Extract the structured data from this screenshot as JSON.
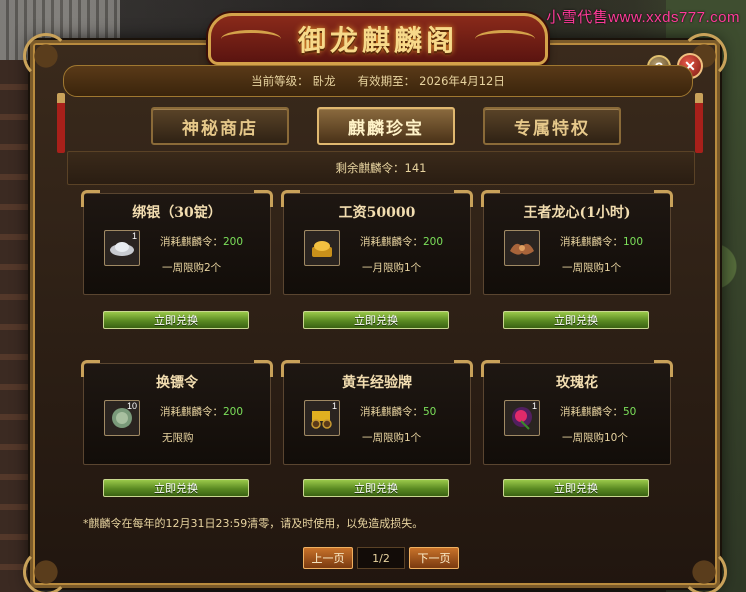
{
  "watermark": "小雪代售www.xxds777.com",
  "window": {
    "title": "御龙麒麟阁",
    "help_label": "?",
    "close_label": "✕"
  },
  "info": {
    "level_label": "当前等级：",
    "level_value": "卧龙",
    "expiry_label": "有效期至：",
    "expiry_value": "2026年4月12日"
  },
  "tabs": [
    {
      "label": "神秘商店",
      "active": false
    },
    {
      "label": "麒麟珍宝",
      "active": true
    },
    {
      "label": "专属特权",
      "active": false
    }
  ],
  "currency": {
    "label": "剩余麒麟令：",
    "value": "141"
  },
  "items": [
    {
      "name": "绑银（30锭）",
      "icon": "silver-ingot-icon",
      "qty": "1",
      "cost_label": "消耗麒麟令：",
      "cost": "200",
      "limit": "一周限购2个",
      "button": "立即兑换"
    },
    {
      "name": "工资50000",
      "icon": "gold-ingot-icon",
      "qty": "",
      "cost_label": "消耗麒麟令：",
      "cost": "200",
      "limit": "一月限购1个",
      "button": "立即兑换"
    },
    {
      "name": "王者龙心(1小时)",
      "icon": "dragon-heart-icon",
      "qty": "",
      "cost_label": "消耗麒麟令：",
      "cost": "100",
      "limit": "一周限购1个",
      "button": "立即兑换"
    },
    {
      "name": "换镖令",
      "icon": "jade-token-icon",
      "qty": "10",
      "cost_label": "消耗麒麟令：",
      "cost": "200",
      "limit": "无限购",
      "button": "立即兑换"
    },
    {
      "name": "黄车经验牌",
      "icon": "gold-cart-icon",
      "qty": "1",
      "cost_label": "消耗麒麟令：",
      "cost": "50",
      "limit": "一周限购1个",
      "button": "立即兑换"
    },
    {
      "name": "玫瑰花",
      "icon": "rose-icon",
      "qty": "1",
      "cost_label": "消耗麒麟令：",
      "cost": "50",
      "limit": "一周限购10个",
      "button": "立即兑换"
    }
  ],
  "footnote": "*麒麟令在每年的12月31日23:59清零，请及时使用，以免造成损失。",
  "pager": {
    "prev": "上一页",
    "page": "1/2",
    "next": "下一页"
  }
}
